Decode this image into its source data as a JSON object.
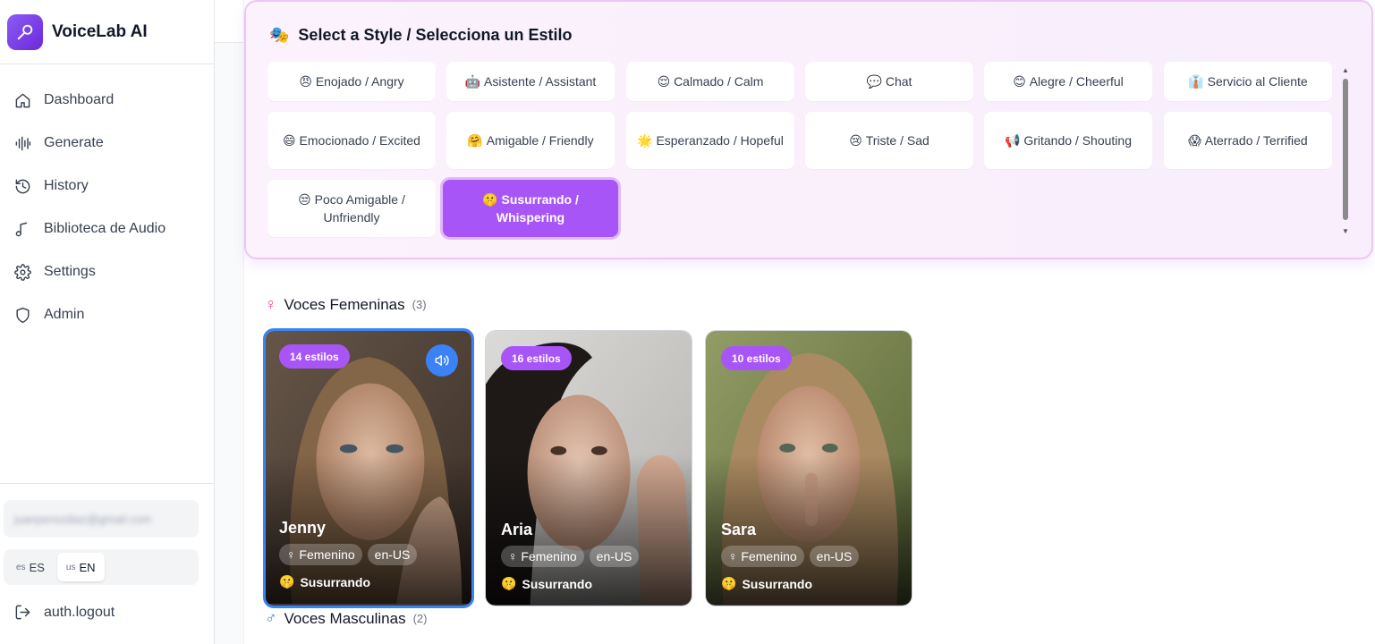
{
  "app": {
    "name": "VoiceLab AI",
    "brand_color": "#7c3aed"
  },
  "sidebar": {
    "items": [
      {
        "label": "Dashboard",
        "icon": "home-icon"
      },
      {
        "label": "Generate",
        "icon": "waveform-icon"
      },
      {
        "label": "History",
        "icon": "history-icon"
      },
      {
        "label": "Biblioteca de Audio",
        "icon": "music-note-icon"
      },
      {
        "label": "Settings",
        "icon": "gear-icon"
      },
      {
        "label": "Admin",
        "icon": "shield-icon"
      }
    ],
    "user_email": "juanperezdiaz@gmail.com",
    "languages": [
      {
        "code": "ES",
        "label": "ES",
        "active": false
      },
      {
        "code": "US",
        "label": "EN",
        "active": true
      }
    ],
    "logout_label": "auth.logout"
  },
  "style_panel": {
    "title_emoji": "🎭",
    "title": "Select a Style / Selecciona un Estilo",
    "styles": [
      {
        "emoji": "😠",
        "label": "Enojado / Angry"
      },
      {
        "emoji": "🤖",
        "label": "Asistente / Assistant"
      },
      {
        "emoji": "😌",
        "label": "Calmado / Calm"
      },
      {
        "emoji": "💬",
        "label": "Chat"
      },
      {
        "emoji": "😊",
        "label": "Alegre / Cheerful"
      },
      {
        "emoji": "👔",
        "label": "Servicio al Cliente"
      },
      {
        "emoji": "😄",
        "label": "Emocionado / Excited"
      },
      {
        "emoji": "🤗",
        "label": "Amigable / Friendly"
      },
      {
        "emoji": "🌟",
        "label": "Esperanzado / Hopeful"
      },
      {
        "emoji": "😢",
        "label": "Triste / Sad"
      },
      {
        "emoji": "📢",
        "label": "Gritando / Shouting"
      },
      {
        "emoji": "😱",
        "label": "Aterrado / Terrified"
      },
      {
        "emoji": "😒",
        "label": "Poco Amigable / Unfriendly"
      },
      {
        "emoji": "🤫",
        "label": "Susurrando / Whispering",
        "selected": true
      }
    ],
    "selected_color": "#a855f7"
  },
  "female_section": {
    "symbol": "♀",
    "label": "Voces Femeninas",
    "count": "(3)"
  },
  "male_section": {
    "symbol": "♂",
    "label": "Voces Masculinas",
    "count": "(2)"
  },
  "voices": [
    {
      "name": "Jenny",
      "styles_badge": "14 estilos",
      "gender": "♀ Femenino",
      "locale": "en-US",
      "style_emoji": "🤫",
      "style": "Susurrando",
      "selected": true
    },
    {
      "name": "Aria",
      "styles_badge": "16 estilos",
      "gender": "♀ Femenino",
      "locale": "en-US",
      "style_emoji": "🤫",
      "style": "Susurrando",
      "selected": false
    },
    {
      "name": "Sara",
      "styles_badge": "10 estilos",
      "gender": "♀ Femenino",
      "locale": "en-US",
      "style_emoji": "🤫",
      "style": "Susurrando",
      "selected": false
    }
  ]
}
